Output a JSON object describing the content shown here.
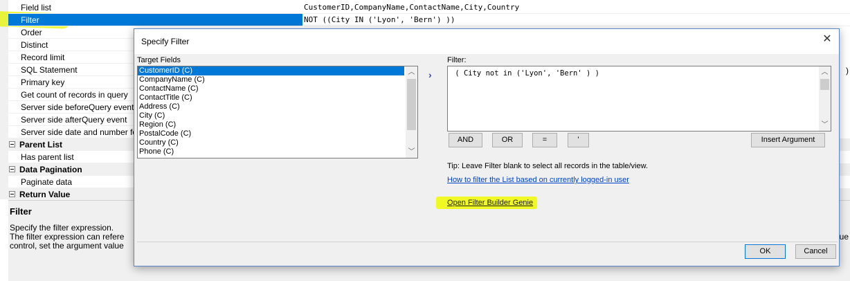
{
  "grid": {
    "rows": [
      {
        "name": "Field list",
        "value": "CustomerID,CompanyName,ContactName,City,Country"
      },
      {
        "name": "Filter",
        "value": "NOT ((City IN ('Lyon', 'Bern') ))"
      },
      {
        "name": "Order",
        "value": ""
      },
      {
        "name": "Distinct",
        "value": ""
      },
      {
        "name": "Record limit",
        "value": ""
      },
      {
        "name": "SQL Statement",
        "value": ""
      },
      {
        "name": "Primary key",
        "value": ""
      },
      {
        "name": "Get count of records in query",
        "value": ""
      },
      {
        "name": "Server side beforeQuery event",
        "value": ""
      },
      {
        "name": "Server side afterQuery event",
        "value": ""
      },
      {
        "name": "Server side date and number form",
        "value": ""
      }
    ],
    "categories": [
      {
        "label": "Parent List",
        "rows": [
          {
            "name": "Has parent list"
          }
        ]
      },
      {
        "label": "Data Pagination",
        "rows": [
          {
            "name": "Paginate data"
          }
        ]
      },
      {
        "label": "Return Value",
        "rows": []
      }
    ],
    "right_paren": ")",
    "highlight_color": "#e6f500"
  },
  "description": {
    "title": "Filter",
    "line1": "Specify the filter expression.",
    "line2": "The filter expression can refere",
    "line3": "control, set the argument value",
    "line2_tail": "ue"
  },
  "dialog": {
    "title": "Specify Filter",
    "close_label": "✕",
    "target_fields_label": "Target Fields",
    "fields": [
      "CustomerID (C)",
      "CompanyName (C)",
      "ContactName (C)",
      "ContactTitle (C)",
      "Address (C)",
      "City (C)",
      "Region (C)",
      "PostalCode (C)",
      "Country (C)",
      "Phone (C)"
    ],
    "filter_label": "Filter:",
    "filter_text": " ( City not in ('Lyon', 'Bern' ) )",
    "operator_buttons": [
      "AND",
      "OR",
      "=",
      "'"
    ],
    "insert_argument_label": "Insert Argument",
    "tip": "Tip: Leave Filter blank to select all records in the table/view.",
    "how_to_link": "How to filter the List based on currently logged-in user",
    "genie_link": "Open Filter Builder Genie",
    "ok_label": "OK",
    "cancel_label": "Cancel",
    "chevron": "›",
    "accent": "#0078d7"
  }
}
